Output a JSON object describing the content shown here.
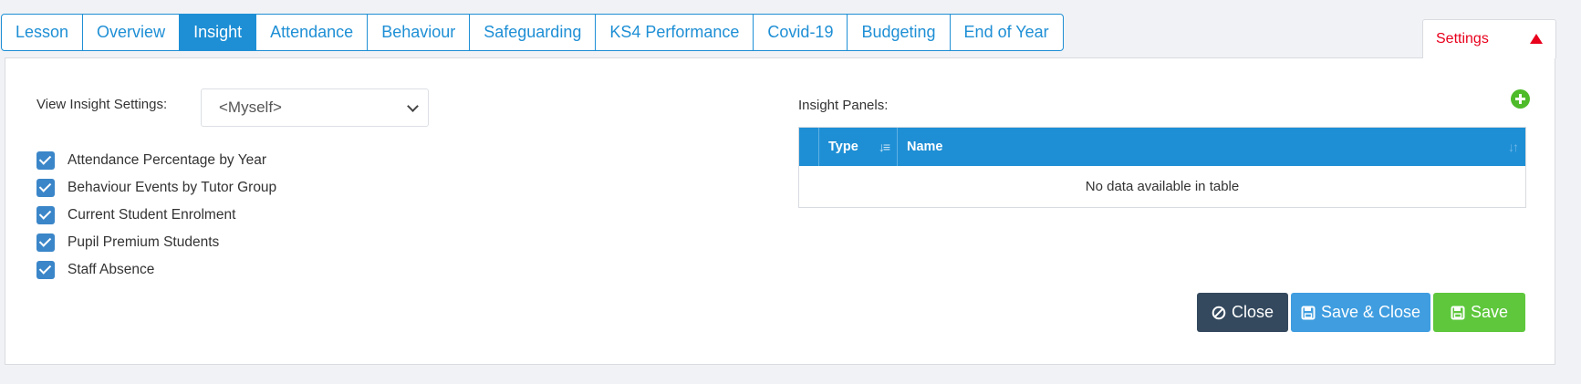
{
  "tabs": [
    {
      "label": "Lesson",
      "active": false
    },
    {
      "label": "Overview",
      "active": false
    },
    {
      "label": "Insight",
      "active": true
    },
    {
      "label": "Attendance",
      "active": false
    },
    {
      "label": "Behaviour",
      "active": false
    },
    {
      "label": "Safeguarding",
      "active": false
    },
    {
      "label": "KS4 Performance",
      "active": false
    },
    {
      "label": "Covid-19",
      "active": false
    },
    {
      "label": "Budgeting",
      "active": false
    },
    {
      "label": "End of Year",
      "active": false
    }
  ],
  "settings_tab": {
    "label": "Settings",
    "icon": "triangle-up-icon",
    "color": "#e8001c"
  },
  "view_settings": {
    "label": "View Insight Settings:",
    "selected": "<Myself>"
  },
  "checklist": [
    {
      "label": "Attendance Percentage by Year",
      "checked": true
    },
    {
      "label": "Behaviour Events by Tutor Group",
      "checked": true
    },
    {
      "label": "Current Student Enrolment",
      "checked": true
    },
    {
      "label": "Pupil Premium Students",
      "checked": true
    },
    {
      "label": "Staff Absence",
      "checked": true
    }
  ],
  "insight_panels": {
    "label": "Insight Panels:",
    "add_icon": "plus-circle-icon",
    "columns": [
      "Type",
      "Name"
    ],
    "empty_message": "No data available in table"
  },
  "buttons": {
    "close": "Close",
    "save_close": "Save & Close",
    "save": "Save"
  },
  "colors": {
    "accent": "#1e8fd5",
    "close": "#34495e",
    "save_close": "#3f9de0",
    "save": "#5ec73c"
  }
}
